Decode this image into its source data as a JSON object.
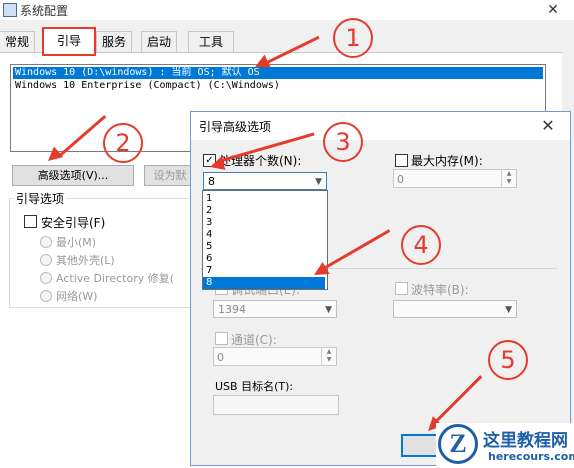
{
  "window": {
    "title": "系统配置",
    "close": "✕"
  },
  "tabs": [
    "常规",
    "引导",
    "服务",
    "启动",
    "工具"
  ],
  "boot_list": {
    "entries": [
      "Windows 10 (D:\\windows) : 当前 OS; 默认 OS",
      "Windows 10 Enterprise (Compact) (C:\\Windows)"
    ]
  },
  "buttons": {
    "advanced": "高级选项(V)...",
    "set_default": "设为默"
  },
  "boot_options": {
    "group_label": "引导选项",
    "safe_boot": "安全引导(F)",
    "radios": [
      "最小(M)",
      "其他外壳(L)",
      "Active Directory 修复(",
      "网络(W)"
    ]
  },
  "dialog": {
    "title": "引导高级选项",
    "close": "✕",
    "num_processors": {
      "label": "处理器个数(N):",
      "value": "8",
      "checked": true
    },
    "max_memory": {
      "label": "最大内存(M):",
      "value": "0",
      "checked": false
    },
    "dropdown_options": [
      "1",
      "2",
      "3",
      "4",
      "5",
      "6",
      "7",
      "8"
    ],
    "debug_port": {
      "label": "调试端口(E):",
      "value": "1394"
    },
    "baud_rate": {
      "label": "波特率(B):"
    },
    "channel": {
      "label": "通道(C):",
      "value": "0"
    },
    "usb_target": {
      "label": "USB 目标名(T):"
    },
    "ok_button": "确"
  },
  "markers": [
    "1",
    "2",
    "3",
    "4",
    "5"
  ],
  "watermark": {
    "logo_letter": "Z",
    "site_name": "这里教程网",
    "url": "herecours.com"
  },
  "colors": {
    "annotation": "#e53b2c",
    "selection": "#0078d7"
  }
}
